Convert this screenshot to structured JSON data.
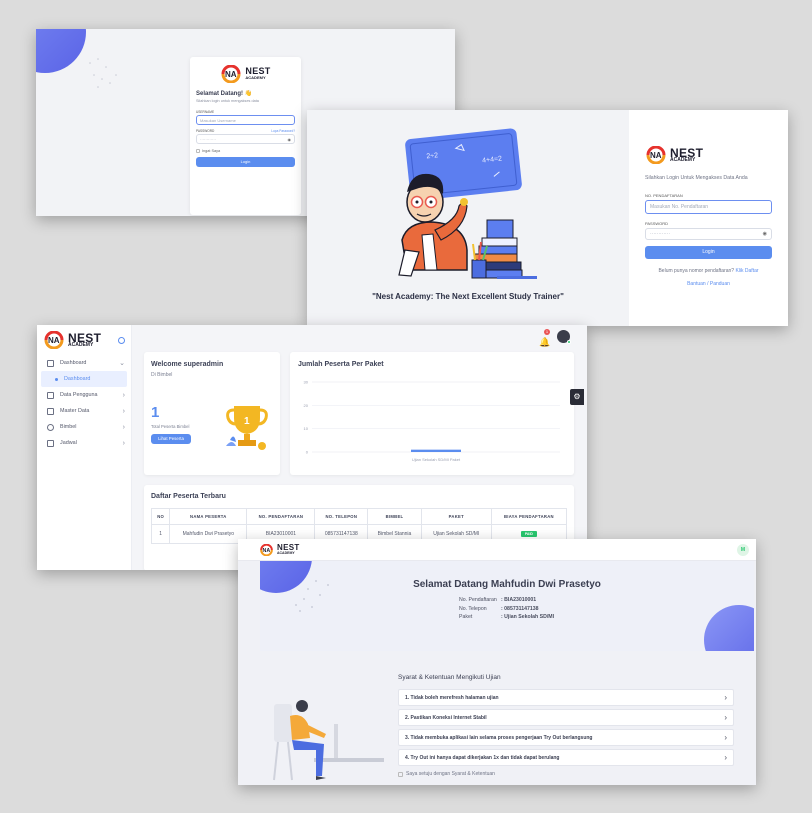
{
  "brand": {
    "name": "NEST",
    "sub": "ACADEMY"
  },
  "panel1": {
    "welcome": "Selamat Datang! 👋",
    "subtitle": "Silahkan login untuk mengakses data",
    "username_label": "USERNAME",
    "username_placeholder": "Masukan Username",
    "password_label": "PASSWORD",
    "forgot": "Lupa Password?",
    "password_dots": "············",
    "remember": "Ingat Saya",
    "login": "Login"
  },
  "panel2": {
    "tagline": "\"Nest Academy: The Next Excellent Study Trainer\"",
    "subtitle": "Silahkan Login Untuk Mengakses Data Anda",
    "reg_label": "NO. PENDAFTARAN",
    "reg_placeholder": "Masukan No. Pendaftaran",
    "password_label": "PASSWORD",
    "password_dots": "············",
    "login": "Login",
    "no_reg_text": "Belum punya nomor pendaftaran?",
    "click_register": "Klik Daftar",
    "help": "Bantuan / Panduan",
    "board_text": [
      "2÷2",
      "4+4=2"
    ]
  },
  "panel3": {
    "nav": [
      {
        "label": "Dashboard",
        "icon": "home-icon"
      },
      {
        "label": "Dashboard",
        "icon": "dot-icon"
      },
      {
        "label": "Data Pengguna",
        "icon": "table-icon"
      },
      {
        "label": "Master Data",
        "icon": "database-icon"
      },
      {
        "label": "Bimbel",
        "icon": "users-icon"
      },
      {
        "label": "Jadwal",
        "icon": "calendar-icon"
      }
    ],
    "notif_count": "1",
    "welcome_title": "Welcome superadmin",
    "welcome_sub": "Di Bimbel",
    "total_value": "1",
    "total_label": "Total Peserta Bimbel",
    "view_button": "Lihat Peserta",
    "chart_title": "Jumlah Peserta Per Paket",
    "table_title": "Daftar Peserta Terbaru",
    "columns": [
      "NO",
      "NAMA PESERTA",
      "NO. PENDAFTARAN",
      "NO. TELEPON",
      "BIMBEL",
      "PAKET",
      "BIAYA PENDAFTARAN"
    ],
    "rows": [
      [
        "1",
        "Mahfudin Dwi Prasetyo",
        "BIA23010001",
        "085731147138",
        "Bimbel Stannia",
        "Ujian Sekolah SD/MI",
        "PAID"
      ]
    ]
  },
  "chart_data": {
    "type": "bar",
    "title": "Jumlah Peserta Per Paket",
    "categories": [
      "Ujian Sekolah SD/MI Paket"
    ],
    "values": [
      1
    ],
    "yticks": [
      "30",
      "20",
      "10",
      "0"
    ],
    "ylim": [
      0,
      30
    ],
    "grid": true,
    "xlabel": "",
    "ylabel": ""
  },
  "panel4": {
    "avatar": "M",
    "title": "Selamat Datang Mahfudin Dwi Prasetyo",
    "info": [
      {
        "label": "No. Pendaftaran",
        "value": "BIA23010001"
      },
      {
        "label": "No. Telepon",
        "value": "085731147138"
      },
      {
        "label": "Paket",
        "value": "Ujian Sekolah SD/MI"
      }
    ],
    "terms_title": "Syarat & Ketentuan Mengikuti Ujian",
    "terms": [
      "1. Tidak boleh merefresh halaman ujian",
      "2. Pastikan Koneksi Internet Stabil",
      "3. Tidak membuka aplikasi lain selama proses pengerjaan Try Out berlangsung",
      "4. Try Out ini hanya dapat dikerjakan 1x dan tidak dapat berulang"
    ],
    "agree": "Saya setuju dengan Syarat & Ketentuan"
  },
  "colors": {
    "primary": "#5b8def",
    "paid": "#28c76f",
    "notif": "#ea5455"
  }
}
